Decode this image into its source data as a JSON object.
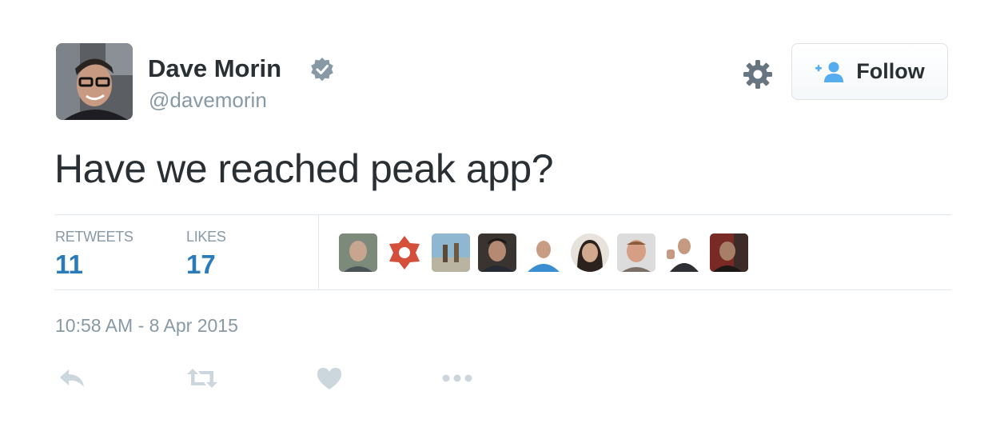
{
  "tweet": {
    "author": {
      "display_name": "Dave Morin",
      "screen_name": "@davemorin",
      "verified": true
    },
    "text": "Have we reached peak app?",
    "timestamp": "10:58 AM - 8 Apr 2015"
  },
  "header": {
    "follow_label": "Follow",
    "gear_icon": "gear-icon",
    "follow_icon": "add-user-icon"
  },
  "stats": {
    "retweets_label": "RETWEETS",
    "retweets_value": "11",
    "likes_label": "LIKES",
    "likes_value": "17"
  },
  "likers_count_shown": 9,
  "actions": [
    "reply-icon",
    "retweet-icon",
    "like-icon",
    "more-icon"
  ],
  "colors": {
    "text": "#292f33",
    "muted": "#8899a6",
    "accent": "#2b7bb9",
    "icon": "#ccd6dd",
    "verified": "#8899a6"
  }
}
